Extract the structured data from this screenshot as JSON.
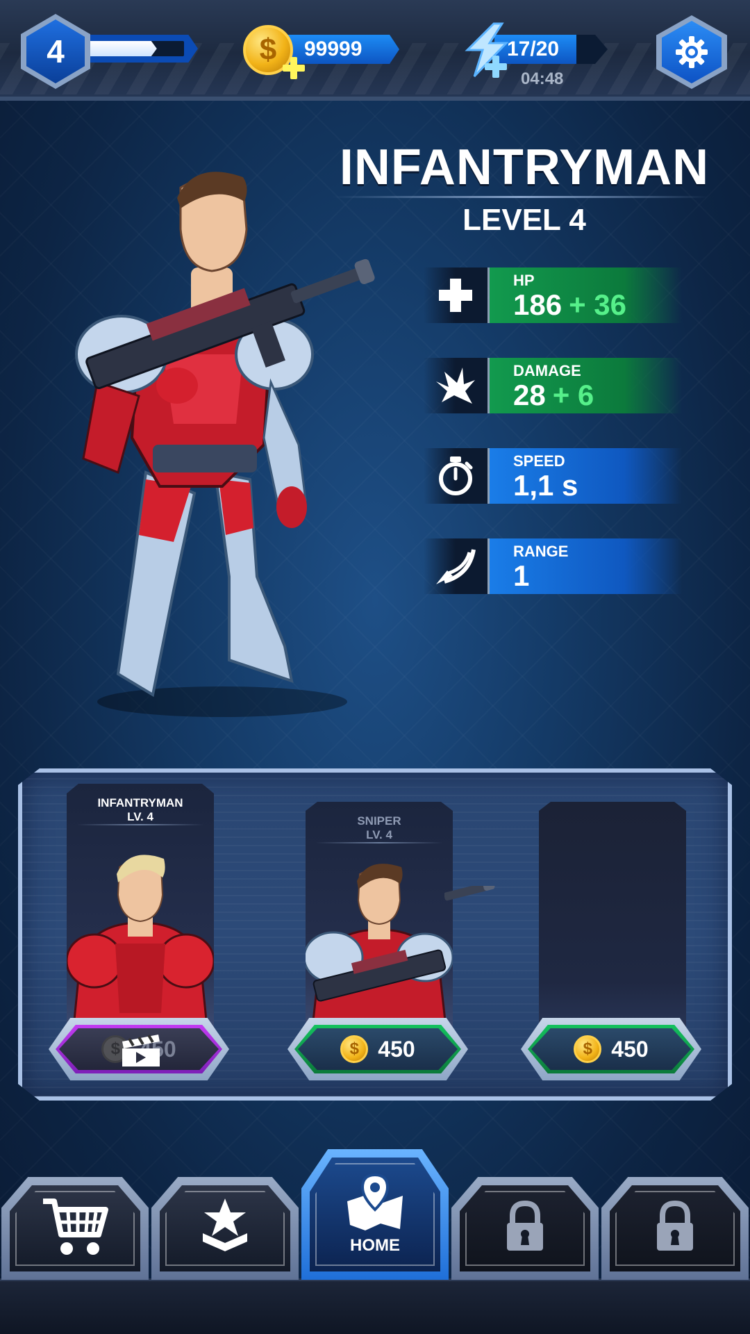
{
  "header": {
    "player_level": "4",
    "xp_progress": 0.72,
    "coins": "99999",
    "energy": "17/20",
    "energy_timer": "04:48"
  },
  "hero": {
    "name": "INFANTRYMAN",
    "level": "LEVEL 4",
    "stats": [
      {
        "label": "HP",
        "value": "186",
        "bonus": "+ 36",
        "icon": "plus-icon",
        "color": "green"
      },
      {
        "label": "DAMAGE",
        "value": "28",
        "bonus": "+ 6",
        "icon": "damage-icon",
        "color": "green"
      },
      {
        "label": "SPEED",
        "value": "1,1 s",
        "bonus": "",
        "icon": "stopwatch-icon",
        "color": "blue"
      },
      {
        "label": "RANGE",
        "value": "1",
        "bonus": "",
        "icon": "range-icon",
        "color": "blue"
      }
    ]
  },
  "roster": {
    "cards": [
      {
        "name": "INFANTRYMAN",
        "level": "LV. 4",
        "price": "450",
        "button_type": "video-ad"
      },
      {
        "name": "SNIPER",
        "level": "LV. 4",
        "price": "450",
        "button_type": "coins"
      },
      {
        "name": "",
        "level": "",
        "price": "450",
        "button_type": "coins"
      }
    ]
  },
  "nav": {
    "tabs": [
      {
        "label": "",
        "icon": "cart-icon"
      },
      {
        "label": "",
        "icon": "rank-icon"
      },
      {
        "label": "HOME",
        "icon": "map-pin-icon"
      },
      {
        "label": "",
        "icon": "lock-icon"
      },
      {
        "label": "",
        "icon": "lock-icon"
      }
    ]
  },
  "colors": {
    "accent_blue": "#1d8cf5",
    "stat_green": "#129a4e",
    "bonus_green": "#56f08a",
    "coin_gold": "#f2b318",
    "ad_purple": "#c23cf2"
  }
}
